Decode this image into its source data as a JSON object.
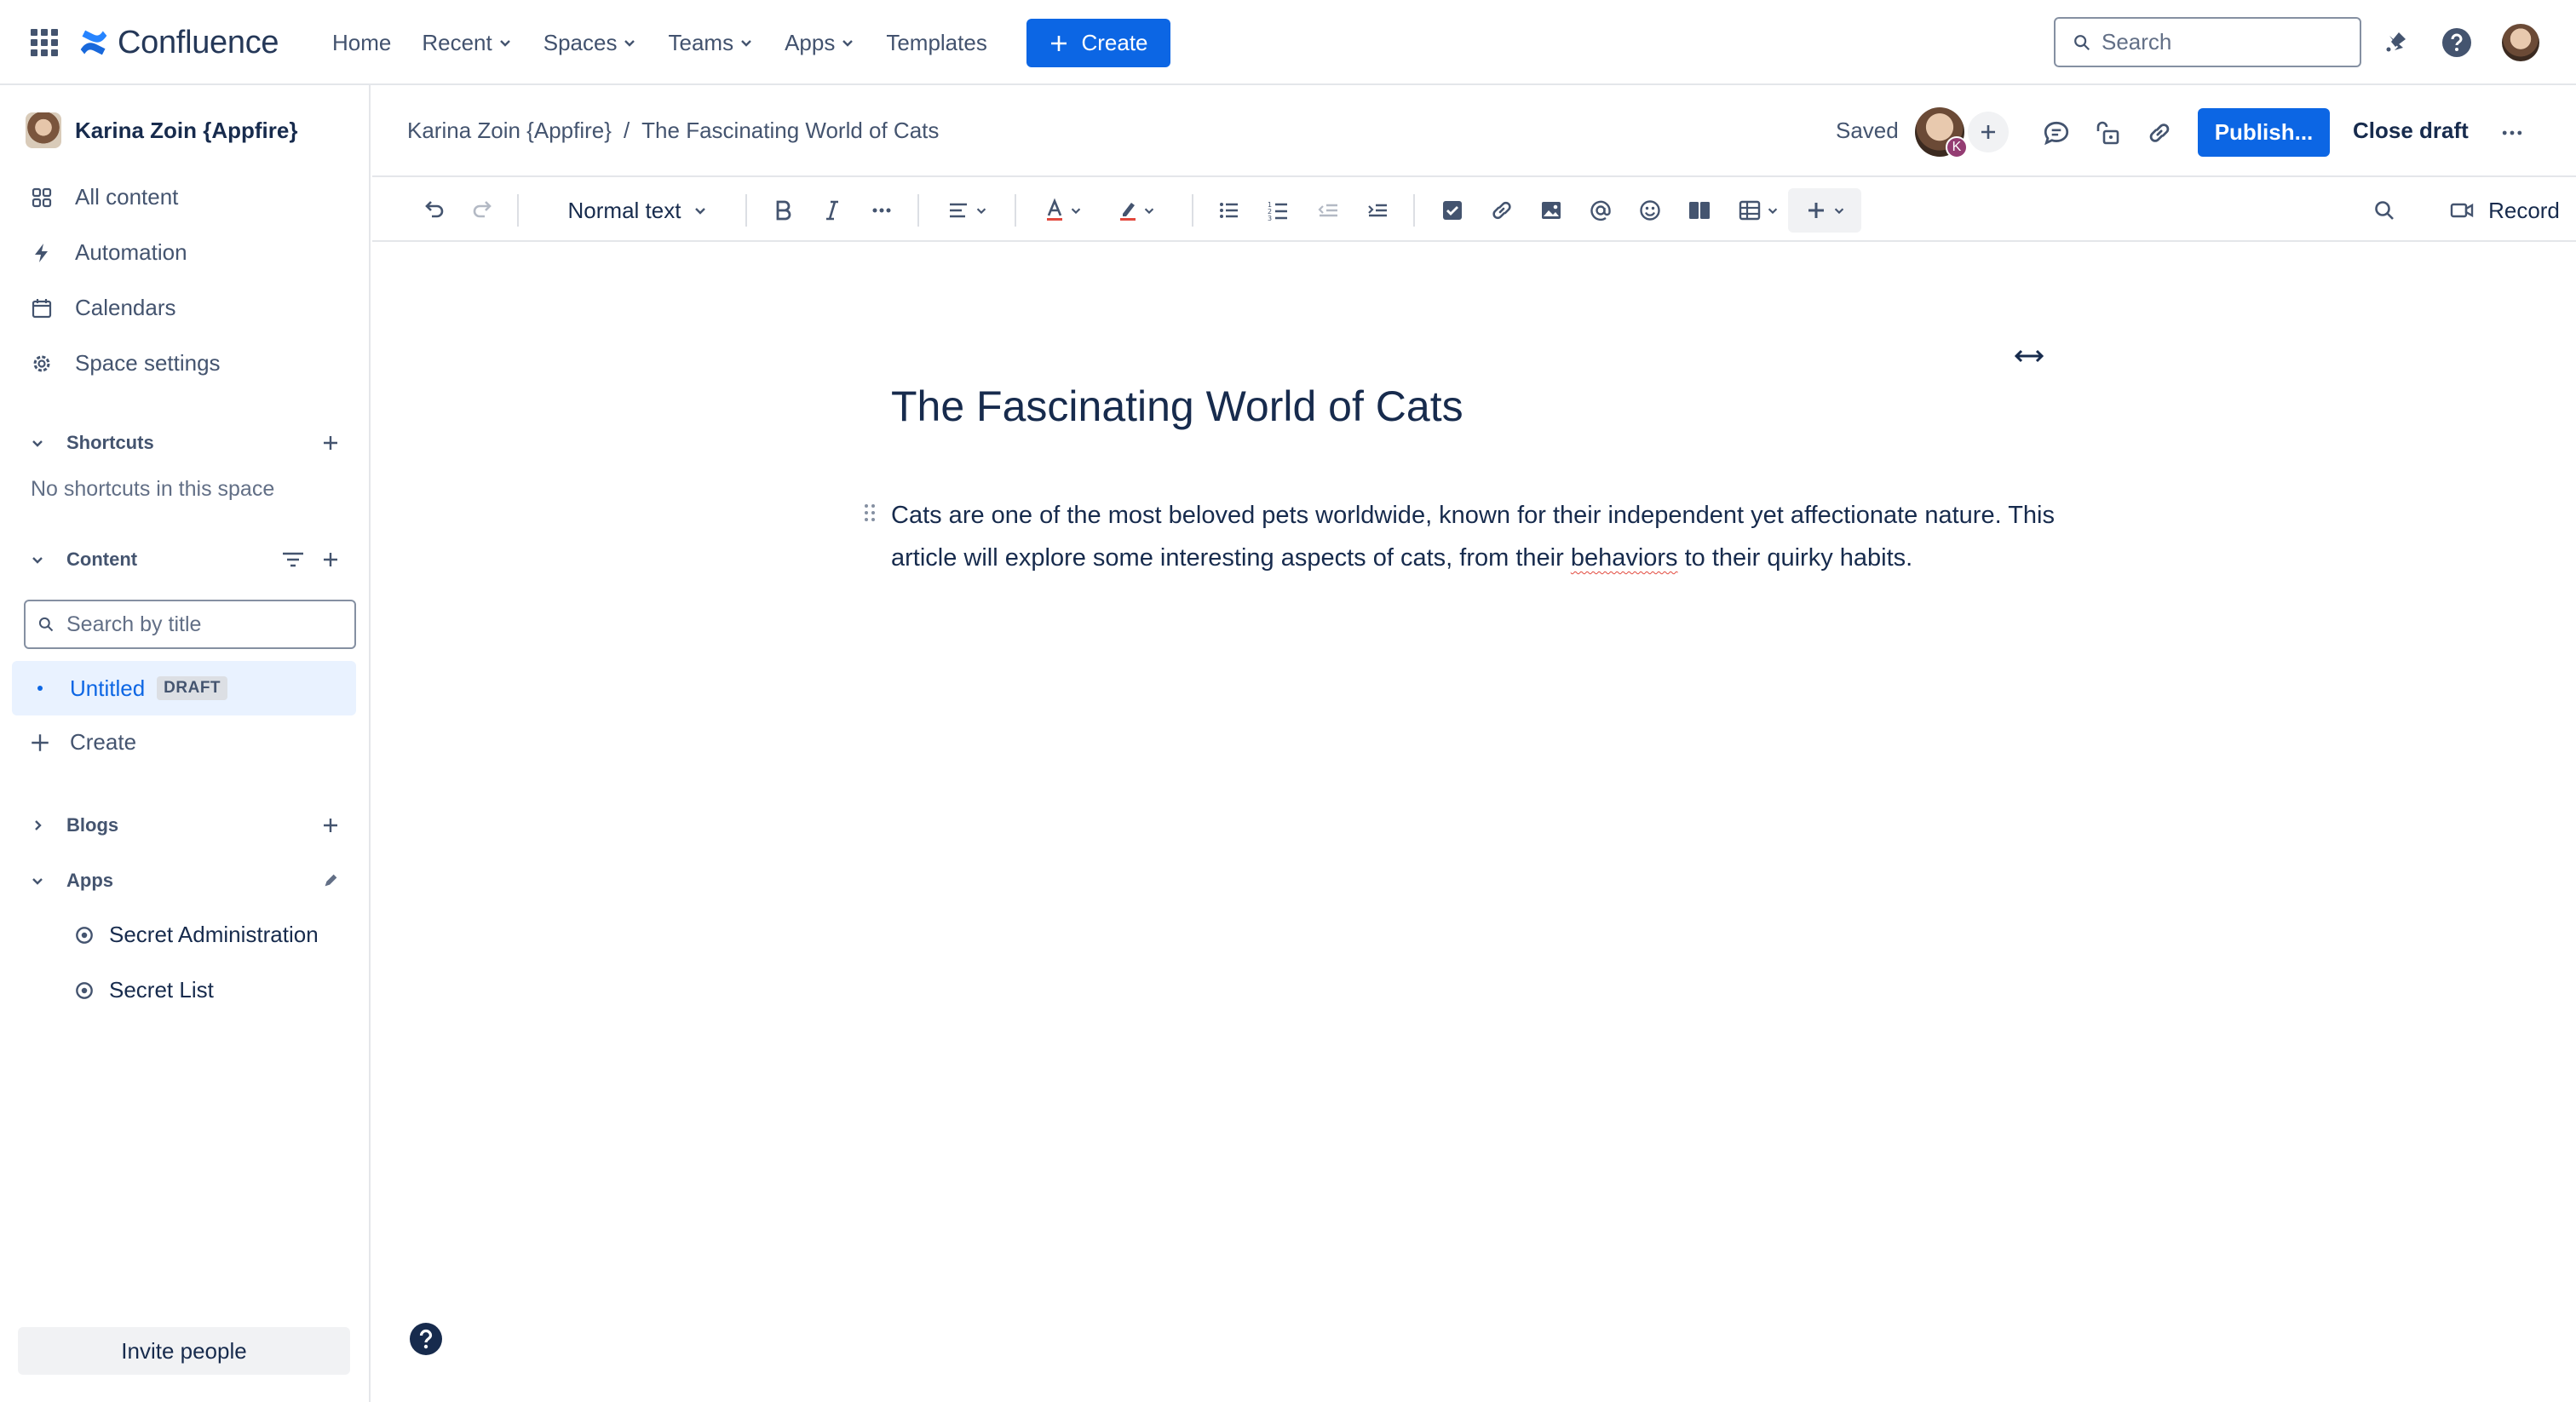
{
  "topnav": {
    "product_name": "Confluence",
    "links": [
      {
        "label": "Home",
        "dropdown": false
      },
      {
        "label": "Recent",
        "dropdown": true
      },
      {
        "label": "Spaces",
        "dropdown": true
      },
      {
        "label": "Teams",
        "dropdown": true
      },
      {
        "label": "Apps",
        "dropdown": true
      },
      {
        "label": "Templates",
        "dropdown": false
      }
    ],
    "create_label": "Create",
    "search_placeholder": "Search",
    "icons": [
      "app-switcher-icon",
      "notifications-icon",
      "help-icon",
      "profile-avatar"
    ]
  },
  "sidebar": {
    "space_name": "Karina Zoin {Appfire}",
    "nav_items": [
      {
        "label": "All content",
        "icon": "grid-icon"
      },
      {
        "label": "Automation",
        "icon": "lightning-icon"
      },
      {
        "label": "Calendars",
        "icon": "calendar-icon"
      },
      {
        "label": "Space settings",
        "icon": "gear-icon"
      }
    ],
    "shortcuts": {
      "label": "Shortcuts",
      "empty_text": "No shortcuts in this space"
    },
    "content": {
      "label": "Content",
      "search_placeholder": "Search by title",
      "tree": [
        {
          "title": "Untitled",
          "badge": "DRAFT"
        }
      ],
      "create_label": "Create"
    },
    "blogs_label": "Blogs",
    "apps": {
      "label": "Apps",
      "items": [
        "Secret Administration",
        "Secret List"
      ]
    },
    "invite_label": "Invite people"
  },
  "pagebar": {
    "breadcrumb": [
      "Karina Zoin {Appfire}",
      "/",
      "The Fascinating World of Cats"
    ],
    "saved_label": "Saved",
    "collaborator_initial": "K",
    "publish_label": "Publish...",
    "close_draft_label": "Close draft"
  },
  "toolbar": {
    "text_style": "Normal text",
    "record_label": "Record"
  },
  "editor": {
    "title": "The Fascinating World of Cats",
    "paragraph_before": "Cats are one of the most beloved pets worldwide, known for their independent yet affectionate nature. This article will explore some interesting aspects of cats, from their ",
    "paragraph_flagged_word": "behaviors",
    "paragraph_after": " to their quirky habits."
  },
  "colors": {
    "primary": "#0c66e4",
    "text": "#172b4d",
    "subtle_text": "#44546f",
    "selected_bg": "#e9f2ff",
    "border": "#e4e6ea"
  }
}
